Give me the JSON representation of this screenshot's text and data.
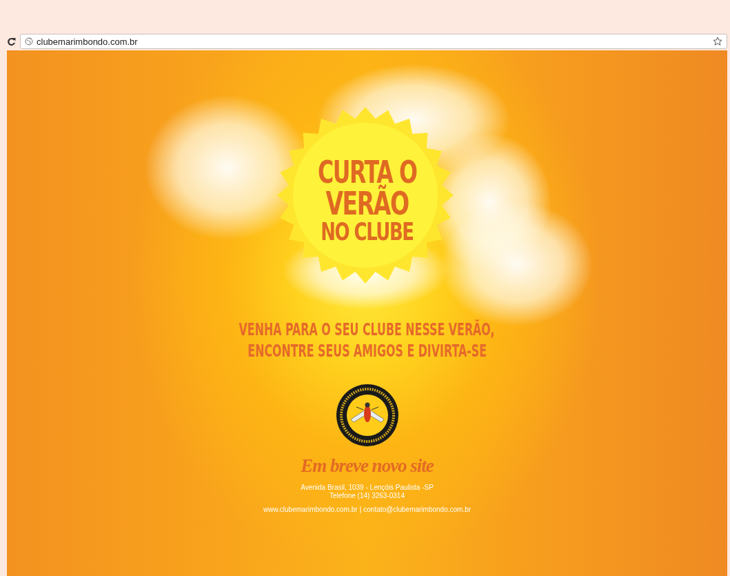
{
  "browser": {
    "url": "clubemarimbondo.com.br"
  },
  "page": {
    "headline": [
      "CURTA O",
      "VERÃO",
      "NO CLUBE"
    ],
    "tagline": [
      "VENHA PARA O SEU CLUBE NESSE VERÃO,",
      "ENCONTRE SEUS AMIGOS E DIVIRTA-SE"
    ],
    "announcement": "Em breve novo site",
    "address": "Avenida Brasil, 1039 - Lençóis Paulista -SP",
    "phone": "Telefone (14) 3263-0314",
    "website": "www.clubemarimbondo.com.br",
    "separator": "|",
    "email": "contato@clubemarimbondo.com.br"
  }
}
